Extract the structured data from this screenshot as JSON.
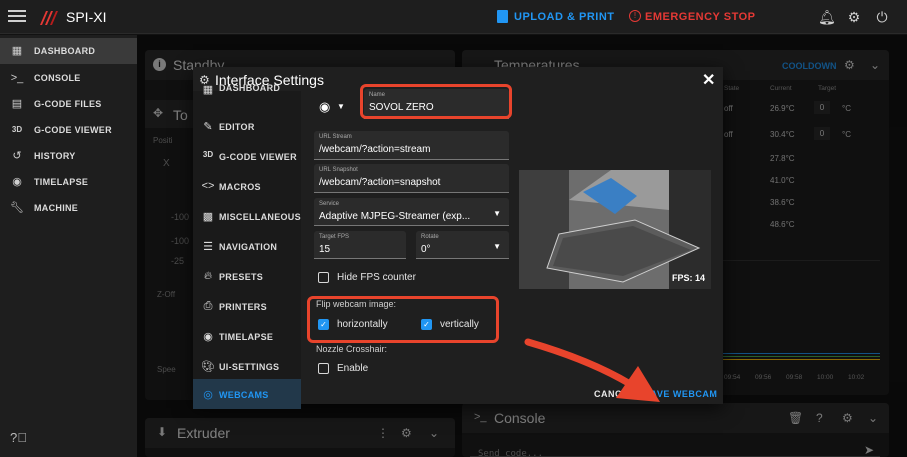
{
  "app": {
    "name": "SPI-XI",
    "upload_label": "UPLOAD & PRINT",
    "estop_label": "EMERGENCY STOP"
  },
  "sidebar": {
    "items": [
      {
        "label": "DASHBOARD",
        "icon": "dashboard-icon"
      },
      {
        "label": "CONSOLE",
        "icon": "console-icon"
      },
      {
        "label": "G-CODE FILES",
        "icon": "file-icon"
      },
      {
        "label": "G-CODE VIEWER",
        "icon": "3d-icon"
      },
      {
        "label": "HISTORY",
        "icon": "history-icon"
      },
      {
        "label": "TIMELAPSE",
        "icon": "timelapse-icon"
      },
      {
        "label": "MACHINE",
        "icon": "wrench-icon"
      }
    ]
  },
  "panels": {
    "standby": "Standby",
    "temperatures": "Temperatures",
    "cooldown": "COOLDOWN",
    "console": "Console",
    "console_placeholder": "Send code...",
    "extruder": "Extruder",
    "toolhead": "To",
    "position": "Positi",
    "x": "X",
    "z_offset": "Z-Off",
    "speed": "Spee",
    "left_values": [
      "-100",
      "-100",
      "-25"
    ]
  },
  "temps": {
    "headers": [
      "State",
      "Current",
      "Target"
    ],
    "rows": [
      {
        "state": "off",
        "current": "26.9°C",
        "target": "0",
        "unit": "°C"
      },
      {
        "state": "off",
        "current": "30.4°C",
        "target": "0",
        "unit": "°C"
      },
      {
        "current": "27.8°C"
      },
      {
        "current": "41.0°C"
      },
      {
        "current": "38.6°C"
      },
      {
        "current": "48.6°C"
      }
    ],
    "axis_ticks": [
      "09:54",
      "09:56",
      "09:58",
      "10:00",
      "10:02"
    ]
  },
  "dialog": {
    "title": "Interface Settings",
    "menu": [
      {
        "label": "DASHBOARD",
        "icon": "dashboard-icon"
      },
      {
        "label": "EDITOR",
        "icon": "editor-icon"
      },
      {
        "label": "G-CODE VIEWER",
        "icon": "3d-icon"
      },
      {
        "label": "MACROS",
        "icon": "code-icon"
      },
      {
        "label": "MISCELLANEOUS",
        "icon": "misc-icon"
      },
      {
        "label": "NAVIGATION",
        "icon": "navigation-icon"
      },
      {
        "label": "PRESETS",
        "icon": "presets-icon"
      },
      {
        "label": "PRINTERS",
        "icon": "printers-icon"
      },
      {
        "label": "TIMELAPSE",
        "icon": "timelapse-icon"
      },
      {
        "label": "UI-SETTINGS",
        "icon": "palette-icon"
      },
      {
        "label": "WEBCAMS",
        "icon": "webcam-icon"
      }
    ],
    "name_label": "Name",
    "name_value": "SOVOL ZERO",
    "url_stream_label": "URL Stream",
    "url_stream_value": "/webcam/?action=stream",
    "url_snapshot_label": "URL Snapshot",
    "url_snapshot_value": "/webcam/?action=snapshot",
    "service_label": "Service",
    "service_value": "Adaptive MJPEG-Streamer (exp...",
    "fps_label": "Target FPS",
    "fps_value": "15",
    "rotate_label": "Rotate",
    "rotate_value": "0°",
    "hide_fps_label": "Hide FPS counter",
    "hide_fps_checked": false,
    "flip_heading": "Flip webcam image:",
    "flip_h_label": "horizontally",
    "flip_h_checked": true,
    "flip_v_label": "vertically",
    "flip_v_checked": true,
    "crosshair_heading": "Nozzle Crosshair:",
    "crosshair_label": "Enable",
    "crosshair_checked": false,
    "preview_fps": "FPS: 14",
    "cancel_label": "CANCEL",
    "save_label": "SAVE WEBCAM"
  },
  "colors": {
    "accent": "#2196f3",
    "estop": "#e53935",
    "highlight": "#e8442c"
  }
}
